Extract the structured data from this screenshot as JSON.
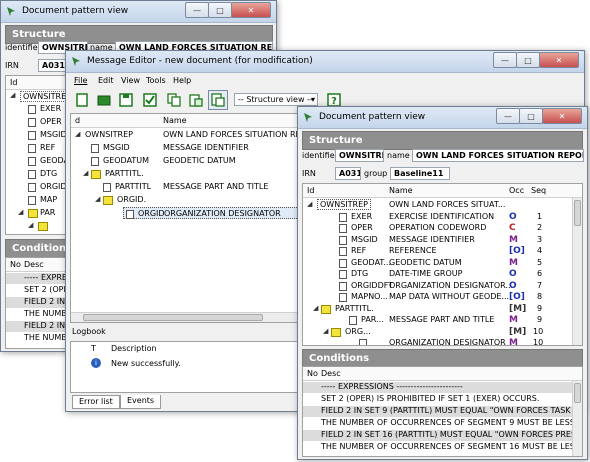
{
  "back_window": {
    "title": "Document pattern view",
    "structure_header": "Structure",
    "identifier_label": "identifier",
    "identifier_value": "OWNSITREP",
    "name_label": "name",
    "name_value": "OWN LAND FORCES SITUATION REPORT",
    "irn_label": "IRN",
    "irn_value": "A031",
    "col_id": "Id",
    "tree": [
      "OWNSITREP",
      "EXER",
      "OPER",
      "MSGID",
      "REF",
      "GEODAT",
      "DTG",
      "ORGID",
      "MAP",
      "PAR"
    ],
    "conditions_header": "Conditions",
    "cond_col_no": "No",
    "cond_col_desc": "Desc",
    "conditions": [
      "----- EXPRESS",
      "SET 2 (OPER)",
      "FIELD 2 IN S",
      "THE NUMB",
      "FIELD 2 IN S",
      "THE NUMB"
    ]
  },
  "editor_window": {
    "title": "Message Editor - new document (for modification)",
    "menu": [
      "File",
      "Edit",
      "View",
      "Tools",
      "Help"
    ],
    "structure_view": "-- Structure view --",
    "col_d": "d",
    "col_name": "Name",
    "tree": [
      {
        "id": "OWNSITREP",
        "name": "OWN LAND FORCES SITUATION REP"
      },
      {
        "id": "MSGID",
        "name": "MESSAGE IDENTIFIER"
      },
      {
        "id": "GEODATUM",
        "name": "GEODETIC DATUM"
      },
      {
        "id": "PARTTITL.",
        "name": ""
      },
      {
        "id": "PARTTITL",
        "name": "MESSAGE PART AND TITLE"
      },
      {
        "id": "ORGID.",
        "name": ""
      },
      {
        "id": "ORGID",
        "name": "ORGANIZATION DESIGNATOR"
      }
    ],
    "logbook_header": "Logbook",
    "log_col_t": "T",
    "log_col_desc": "Description",
    "log_entries": [
      {
        "type": "info",
        "description": "New successfully."
      }
    ],
    "tabs": [
      "Error list",
      "Events"
    ],
    "active_tab": "Events"
  },
  "front_window": {
    "title": "Document pattern view",
    "structure_header": "Structure",
    "identifier_label": "identifier",
    "identifier_value": "OWNSITREP",
    "name_label": "name",
    "name_value": "OWN LAND FORCES SITUATION REPORT",
    "irn_label": "IRN",
    "irn_value": "A031",
    "group_label": "group",
    "group_value": "Baseline11",
    "col_id": "Id",
    "col_name": "Name",
    "col_occ": "Occ",
    "col_seq": "Seq",
    "rows": [
      {
        "id": "OWNSITREP",
        "name": "OWN LAND FORCES SITUAT...",
        "occ": "",
        "seq": ""
      },
      {
        "id": "EXER",
        "name": "EXERCISE IDENTIFICATION",
        "occ": "O",
        "seq": "1"
      },
      {
        "id": "OPER",
        "name": "OPERATION CODEWORD",
        "occ": "C",
        "seq": "2"
      },
      {
        "id": "MSGID",
        "name": "MESSAGE IDENTIFIER",
        "occ": "M",
        "seq": "3"
      },
      {
        "id": "REF",
        "name": "REFERENCE",
        "occ": "[O]",
        "seq": "4"
      },
      {
        "id": "GEODAT...",
        "name": "GEODETIC DATUM",
        "occ": "M",
        "seq": "5"
      },
      {
        "id": "DTG",
        "name": "DATE-TIME GROUP",
        "occ": "O",
        "seq": "6"
      },
      {
        "id": "ORGIDDFT",
        "name": "ORGANIZATION DESIGNATOR...",
        "occ": "O",
        "seq": "7"
      },
      {
        "id": "MAPNO...",
        "name": "MAP DATA WITHOUT GEODE...",
        "occ": "[O]",
        "seq": "8"
      },
      {
        "id": "PARTTITL.",
        "name": "",
        "occ": "[M]",
        "seq": "9"
      },
      {
        "id": "PAR...",
        "name": "MESSAGE PART AND TITLE",
        "occ": "M",
        "seq": "9"
      },
      {
        "id": "ORG...",
        "name": "",
        "occ": "[M]",
        "seq": "10"
      },
      {
        "id": "",
        "name": "ORGANIZATION DESIGNATOR",
        "occ": "M",
        "seq": "10"
      }
    ],
    "conditions_header": "Conditions",
    "cond_col_no": "No",
    "cond_col_desc": "Desc",
    "conditions": [
      "----- EXPRESSIONS -----------------------",
      "SET 2 (OPER) IS PROHIBITED IF SET 1 (EXER) OCCURS.",
      "FIELD 2 IN SET 9 (PARTTITL) MUST EQUAL \"OWN FORCES TASK OR",
      "THE NUMBER OF OCCURRENCES OF SEGMENT 9 MUST BE LESS T",
      "FIELD 2 IN SET 16 (PARTTITL) MUST EQUAL \"OWN FORCES PRESEN",
      "THE NUMBER OF OCCURRENCES OF SEGMENT 16 MUST BE LESS"
    ]
  },
  "colors": {
    "title_bar": "#c4d5ea",
    "section_header": "#8f8f8f",
    "close_button": "#c75050",
    "occ_blue": "#1a2fb0",
    "occ_red": "#c02020",
    "occ_purple": "#7a1f8f"
  }
}
